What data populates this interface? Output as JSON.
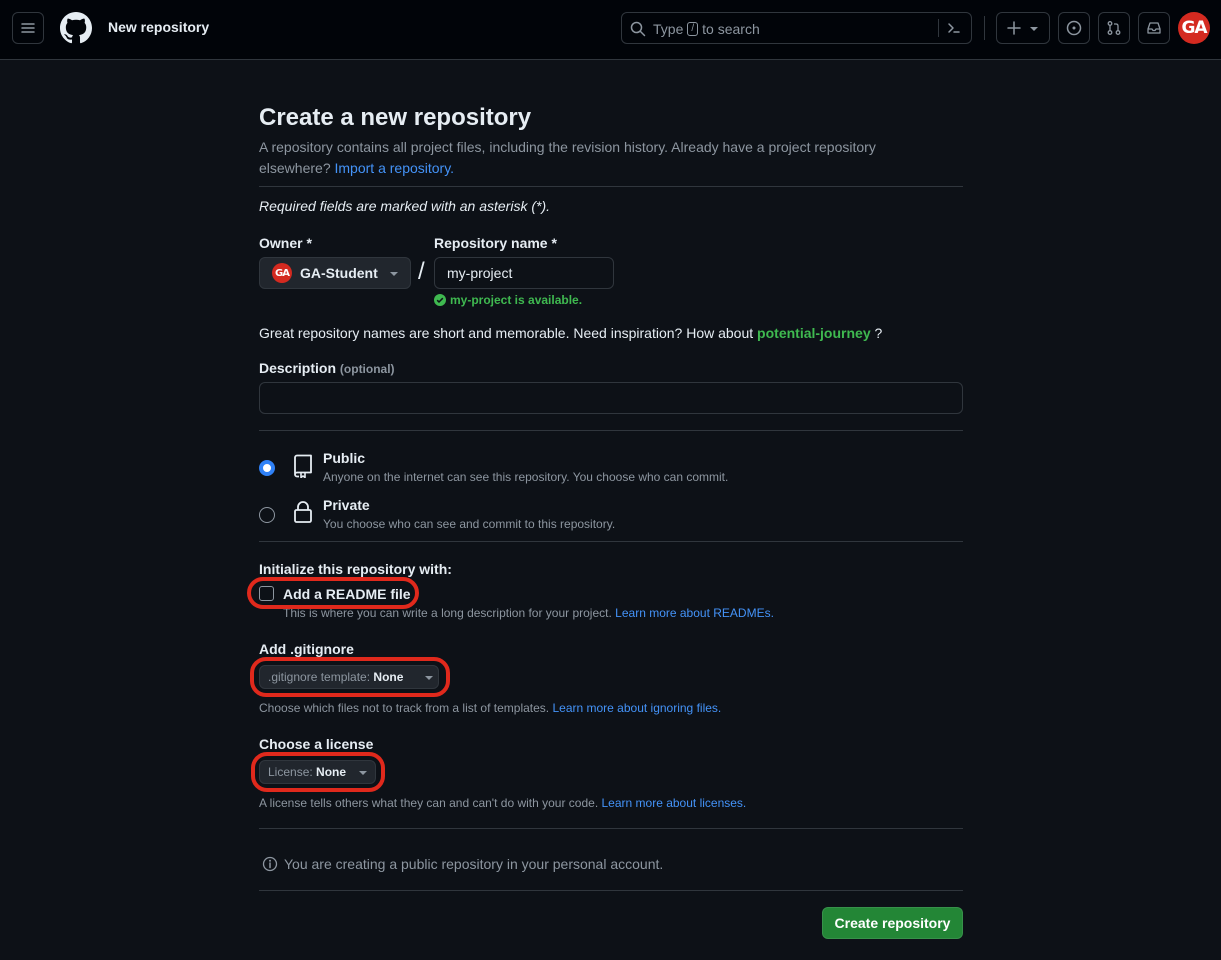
{
  "header": {
    "title": "New repository",
    "search_prefix": "Type",
    "search_key": "/",
    "search_suffix": "to search",
    "avatar_text": "GA"
  },
  "page": {
    "title": "Create a new repository",
    "intro": "A repository contains all project files, including the revision history. Already have a project repository elsewhere?",
    "import_link": "Import a repository.",
    "required_note": "Required fields are marked with an asterisk (*)."
  },
  "owner": {
    "label": "Owner *",
    "value": "GA-Student",
    "avatar_text": "GA"
  },
  "repo": {
    "label": "Repository name *",
    "value": "my-project",
    "availability": "my-project is available."
  },
  "suggestion": {
    "text": "Great repository names are short and memorable. Need inspiration? How about",
    "name": "potential-journey",
    "suffix": "?"
  },
  "description": {
    "label": "Description",
    "optional": "(optional)",
    "value": ""
  },
  "visibility": {
    "public_title": "Public",
    "public_desc": "Anyone on the internet can see this repository. You choose who can commit.",
    "private_title": "Private",
    "private_desc": "You choose who can see and commit to this repository.",
    "selected": "public"
  },
  "init": {
    "heading": "Initialize this repository with:",
    "readme_label": "Add a README file",
    "readme_desc": "This is where you can write a long description for your project.",
    "readme_link": "Learn more about READMEs.",
    "readme_checked": false
  },
  "gitignore": {
    "heading": "Add .gitignore",
    "button_prefix": ".gitignore template:",
    "button_value": "None",
    "hint": "Choose which files not to track from a list of templates.",
    "hint_link": "Learn more about ignoring files."
  },
  "license": {
    "heading": "Choose a license",
    "button_prefix": "License:",
    "button_value": "None",
    "hint": "A license tells others what they can and can't do with your code.",
    "hint_link": "Learn more about licenses."
  },
  "notice": "You are creating a public repository in your personal account.",
  "submit_label": "Create repository",
  "colors": {
    "background": "#0d1117",
    "header": "#010409",
    "accent_link": "#4493f8",
    "success": "#3fb950",
    "primary_button": "#238636",
    "highlight_ring": "#e0291c"
  }
}
